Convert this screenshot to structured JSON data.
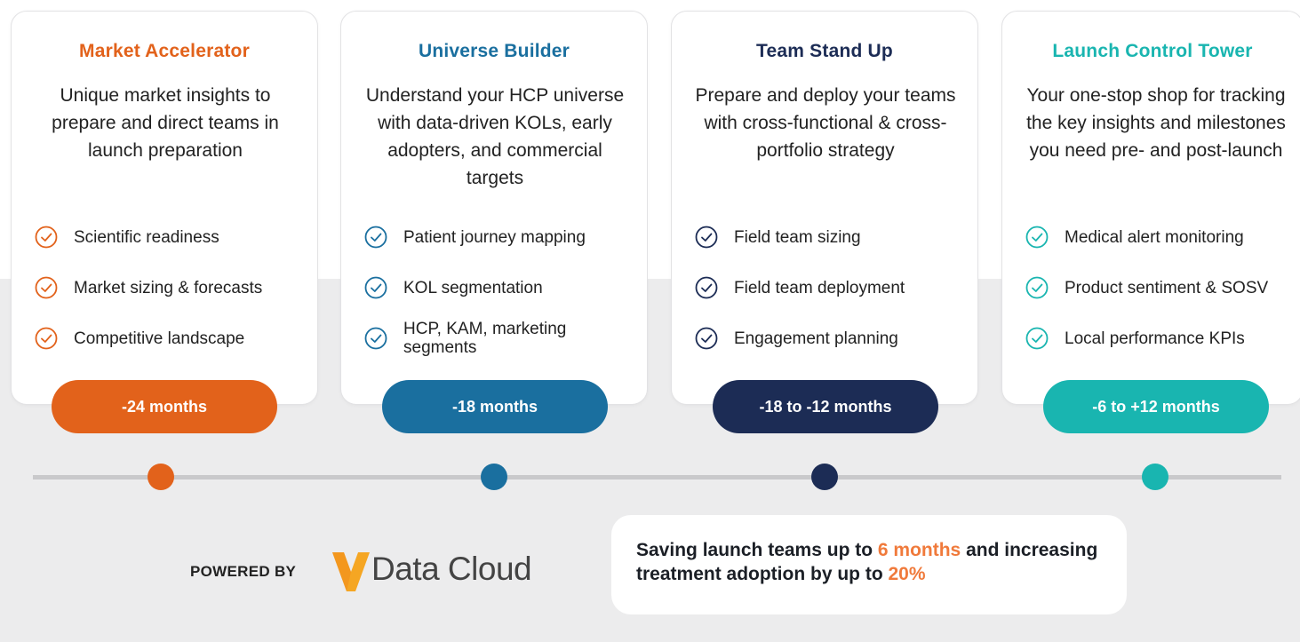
{
  "colors": {
    "orange": "#e2621b",
    "blue": "#1a6f9f",
    "navy": "#1c2c55",
    "teal": "#19b5b0",
    "highlight": "#f07a3b",
    "check_orange": "#e2621b",
    "check_blue": "#1a6f9f",
    "check_navy": "#1c2c55",
    "check_teal": "#19b5b0"
  },
  "cards": [
    {
      "title": "Market Accelerator",
      "desc": "Unique market insights to prepare and direct teams in launch preparation",
      "features": [
        "Scientific readiness",
        "Market sizing & forecasts",
        "Competitive landscape"
      ],
      "timing": "-24 months"
    },
    {
      "title": "Universe Builder",
      "desc": "Understand your HCP universe with data-driven KOLs, early adopters, and commercial targets",
      "features": [
        "Patient journey mapping",
        "KOL segmentation",
        "HCP, KAM, marketing segments"
      ],
      "timing": "-18 months"
    },
    {
      "title": "Team Stand Up",
      "desc": "Prepare and deploy your teams with cross-functional & cross-portfolio strategy",
      "features": [
        "Field team sizing",
        "Field team deployment",
        "Engagement planning"
      ],
      "timing": "-18 to -12 months"
    },
    {
      "title": "Launch Control Tower",
      "desc": "Your one-stop shop for tracking the key insights and milestones you need pre- and post-launch",
      "features": [
        "Medical alert monitoring",
        "Product sentiment & SOSV",
        "Local performance KPIs"
      ],
      "timing": "-6 to +12 months"
    }
  ],
  "footer": {
    "powered_by": "POWERED BY",
    "logo_text": "Data Cloud",
    "claim": {
      "part1": "Saving launch teams up to ",
      "highlight1": "6 months",
      "part2": " and increasing treatment adoption by up to ",
      "highlight2": "20%"
    }
  }
}
